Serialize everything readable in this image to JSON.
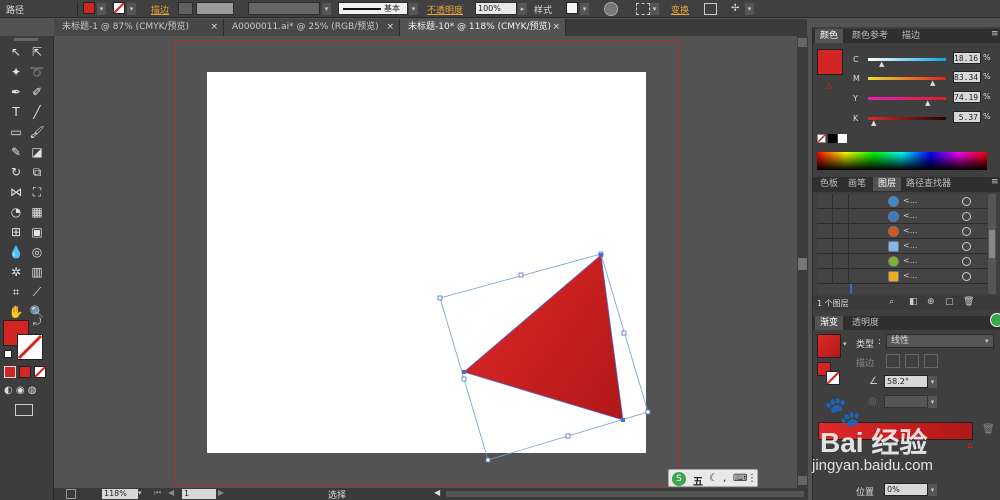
{
  "control_bar": {
    "selection_label": "路径",
    "stroke_label": "描边",
    "stroke_style_label": "基本",
    "opacity_label": "不透明度",
    "opacity_value": "100%",
    "style_label": "样式",
    "transform_label": "变换",
    "fill_color": "#d42525"
  },
  "tabs": [
    {
      "label": "未标题-1 @ 87% (CMYK/预览)",
      "close": "×"
    },
    {
      "label": "A0000011.ai* @ 25% (RGB/预览)",
      "close": "×"
    },
    {
      "label": "未标题-10* @ 118% (CMYK/预览)",
      "close": "×"
    }
  ],
  "color_panel": {
    "tabs": [
      "颜色",
      "颜色参考",
      "描边"
    ],
    "swatch_color": "#d42525",
    "channels": [
      {
        "label": "C",
        "value": "18.16"
      },
      {
        "label": "M",
        "value": "83.34"
      },
      {
        "label": "Y",
        "value": "74.19"
      },
      {
        "label": "K",
        "value": "5.37"
      }
    ],
    "percent": "%"
  },
  "layers_panel": {
    "tabs": [
      "色板",
      "画笔",
      "图层",
      "路径查找器"
    ],
    "items": [
      {
        "name": "<...",
        "thumb_color": "#3a8ad4"
      },
      {
        "name": "<...",
        "thumb_color": "#3a7ac8"
      },
      {
        "name": "<...",
        "thumb_color": "#d8551a"
      },
      {
        "name": "<...",
        "thumb_color": "#80b8e8"
      },
      {
        "name": "<...",
        "thumb_color": "#7ab832"
      },
      {
        "name": "<...",
        "thumb_color": "#e8b020"
      }
    ],
    "footer": "1 个图层"
  },
  "gradient_panel": {
    "tabs": [
      "渐变",
      "透明度"
    ],
    "type_label": "类型",
    "type_value": "线性",
    "stroke_label": "描边",
    "angle_value": "58.2°",
    "location_label": "位置",
    "location_value": "0%",
    "start_color": "#e02828",
    "end_color": "#b01818"
  },
  "status_bar": {
    "zoom": "118%",
    "page": "1",
    "mode": "选择"
  },
  "ime": {
    "label": "五"
  },
  "watermark": {
    "text": "Bai 经验",
    "url": "jingyan.baidu.com"
  },
  "colors": {
    "accent_red": "#d42525",
    "selection_blue": "#4a6fd0",
    "artboard_border": "#b03030"
  }
}
